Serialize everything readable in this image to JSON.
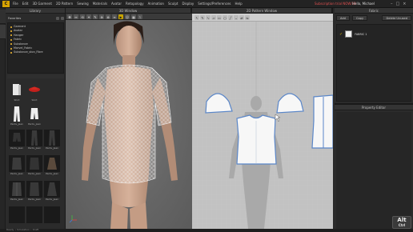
{
  "app": {
    "logo_text": "C",
    "menus": [
      "File",
      "Edit",
      "3D Garment",
      "2D Pattern",
      "Sewing",
      "Materials",
      "Avatar",
      "Retopology",
      "Animation",
      "Sculpt",
      "Display",
      "Settings/Preferences",
      "Help"
    ],
    "promo_text": "Subscription trial NOW/19",
    "user_greeting": "Hello, Michael",
    "window_buttons": [
      "–",
      "□",
      "×"
    ]
  },
  "library": {
    "title": "Library",
    "favorites_label": "Favorites",
    "tree_items": [
      "Garment",
      "Avatar",
      "Hanger",
      "Fabric",
      "Substance",
      "Marvel_Fabric",
      "Substance_ston_Fibre"
    ],
    "thumbnails": [
      {
        "label": "Shirt"
      },
      {
        "label": "Skirt"
      },
      {
        "label": ""
      },
      {
        "label": "Pants_Jean"
      },
      {
        "label": "Pants_Jean"
      },
      {
        "label": ""
      },
      {
        "label": "Pants_Jean"
      },
      {
        "label": "Pants_Jean"
      },
      {
        "label": "Pants_Jean"
      },
      {
        "label": "Pants_Jean"
      },
      {
        "label": "Pants_Jean"
      },
      {
        "label": "Pants_Jean"
      },
      {
        "label": "Pants_Jean"
      },
      {
        "label": "Pants_Jean"
      },
      {
        "label": "Pants_Jean"
      }
    ]
  },
  "window3d": {
    "title": "3D Window"
  },
  "window2d": {
    "title": "2D Pattern Window"
  },
  "object_browser": {
    "title": "Fabric",
    "add_label": "Add",
    "copy_label": "Copy",
    "delete_label": "Delete Unused",
    "item_label": "FABRIC 1"
  },
  "property_editor": {
    "title": "Property Editor"
  },
  "status_bar": {
    "text": "Ready  •  Simulation  •  Draft"
  },
  "watermark": {
    "line1": "Alt",
    "line2": "Ctrl"
  },
  "colors": {
    "accent": "#d6a200",
    "pattern_outline": "#5a86c8",
    "promo": "#e05050"
  }
}
